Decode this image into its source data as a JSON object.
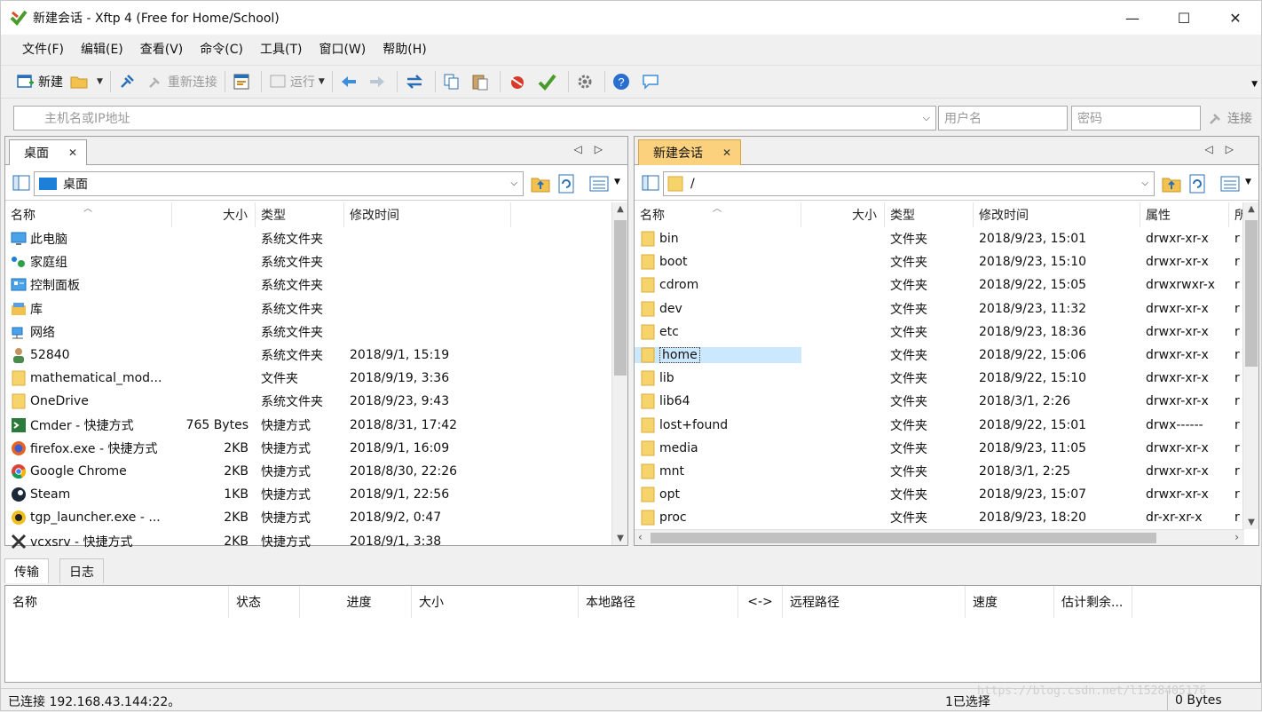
{
  "window": {
    "title": "新建会话 - Xftp 4 (Free for Home/School)",
    "controls": {
      "minimize": "—",
      "maximize": "☐",
      "close": "✕"
    }
  },
  "menu": [
    "文件(F)",
    "编辑(E)",
    "查看(V)",
    "命令(C)",
    "工具(T)",
    "窗口(W)",
    "帮助(H)"
  ],
  "toolbar": {
    "new_label": "新建",
    "reconnect_label": "重新连接",
    "run_label": "运行"
  },
  "address": {
    "host_placeholder": "主机名或IP地址",
    "user_placeholder": "用户名",
    "password_placeholder": "密码",
    "connect_label": "连接"
  },
  "left_pane": {
    "tab": "桌面",
    "path": "桌面",
    "columns": [
      "名称",
      "大小",
      "类型",
      "修改时间"
    ],
    "rows": [
      {
        "name": "此电脑",
        "size": "",
        "type": "系统文件夹",
        "modified": "",
        "icon": "computer-icon"
      },
      {
        "name": "家庭组",
        "size": "",
        "type": "系统文件夹",
        "modified": "",
        "icon": "homegroup-icon"
      },
      {
        "name": "控制面板",
        "size": "",
        "type": "系统文件夹",
        "modified": "",
        "icon": "control-panel-icon"
      },
      {
        "name": "库",
        "size": "",
        "type": "系统文件夹",
        "modified": "",
        "icon": "library-icon"
      },
      {
        "name": "网络",
        "size": "",
        "type": "系统文件夹",
        "modified": "",
        "icon": "network-icon"
      },
      {
        "name": "52840",
        "size": "",
        "type": "系统文件夹",
        "modified": "2018/9/1, 15:19",
        "icon": "user-icon"
      },
      {
        "name": "mathematical_mod...",
        "size": "",
        "type": "文件夹",
        "modified": "2018/9/19, 3:36",
        "icon": "folder-icon"
      },
      {
        "name": "OneDrive",
        "size": "",
        "type": "系统文件夹",
        "modified": "2018/9/23, 9:43",
        "icon": "folder-icon"
      },
      {
        "name": "Cmder - 快捷方式",
        "size": "765 Bytes",
        "type": "快捷方式",
        "modified": "2018/8/31, 17:42",
        "icon": "cmder-icon"
      },
      {
        "name": "firefox.exe - 快捷方式",
        "size": "2KB",
        "type": "快捷方式",
        "modified": "2018/9/1, 16:09",
        "icon": "firefox-icon"
      },
      {
        "name": "Google Chrome",
        "size": "2KB",
        "type": "快捷方式",
        "modified": "2018/8/30, 22:26",
        "icon": "chrome-icon"
      },
      {
        "name": "Steam",
        "size": "1KB",
        "type": "快捷方式",
        "modified": "2018/9/1, 22:56",
        "icon": "steam-icon"
      },
      {
        "name": "tgp_launcher.exe - ...",
        "size": "2KB",
        "type": "快捷方式",
        "modified": "2018/9/2, 0:47",
        "icon": "tgp-icon"
      },
      {
        "name": "vcxsrv - 快捷方式",
        "size": "2KB",
        "type": "快捷方式",
        "modified": "2018/9/1, 3:38",
        "icon": "x-icon"
      }
    ]
  },
  "right_pane": {
    "tab": "新建会话",
    "path": "/",
    "columns": [
      "名称",
      "大小",
      "类型",
      "修改时间",
      "属性",
      "所"
    ],
    "rows": [
      {
        "name": "bin",
        "type": "文件夹",
        "modified": "2018/9/23, 15:01",
        "attr": "drwxr-xr-x",
        "owner": "r"
      },
      {
        "name": "boot",
        "type": "文件夹",
        "modified": "2018/9/23, 15:10",
        "attr": "drwxr-xr-x",
        "owner": "r"
      },
      {
        "name": "cdrom",
        "type": "文件夹",
        "modified": "2018/9/22, 15:05",
        "attr": "drwxrwxr-x",
        "owner": "r"
      },
      {
        "name": "dev",
        "type": "文件夹",
        "modified": "2018/9/23, 11:32",
        "attr": "drwxr-xr-x",
        "owner": "r"
      },
      {
        "name": "etc",
        "type": "文件夹",
        "modified": "2018/9/23, 18:36",
        "attr": "drwxr-xr-x",
        "owner": "r"
      },
      {
        "name": "home",
        "type": "文件夹",
        "modified": "2018/9/22, 15:06",
        "attr": "drwxr-xr-x",
        "owner": "r",
        "selected": true
      },
      {
        "name": "lib",
        "type": "文件夹",
        "modified": "2018/9/22, 15:10",
        "attr": "drwxr-xr-x",
        "owner": "r"
      },
      {
        "name": "lib64",
        "type": "文件夹",
        "modified": "2018/3/1, 2:26",
        "attr": "drwxr-xr-x",
        "owner": "r"
      },
      {
        "name": "lost+found",
        "type": "文件夹",
        "modified": "2018/9/22, 15:01",
        "attr": "drwx------",
        "owner": "r"
      },
      {
        "name": "media",
        "type": "文件夹",
        "modified": "2018/9/23, 11:05",
        "attr": "drwxr-xr-x",
        "owner": "r"
      },
      {
        "name": "mnt",
        "type": "文件夹",
        "modified": "2018/3/1, 2:25",
        "attr": "drwxr-xr-x",
        "owner": "r"
      },
      {
        "name": "opt",
        "type": "文件夹",
        "modified": "2018/9/23, 15:07",
        "attr": "drwxr-xr-x",
        "owner": "r"
      },
      {
        "name": "proc",
        "type": "文件夹",
        "modified": "2018/9/23, 18:20",
        "attr": "dr-xr-xr-x",
        "owner": "r"
      }
    ]
  },
  "bottom_tabs": [
    "传输",
    "日志"
  ],
  "transfer_columns": [
    "名称",
    "状态",
    "进度",
    "大小",
    "本地路径",
    "<->",
    "远程路径",
    "速度",
    "估计剩余..."
  ],
  "status": {
    "left": "已连接 192.168.43.144:22。",
    "mid": "1已选择",
    "right": "0 Bytes"
  },
  "watermark": "https://blog.csdn.net/l1528405176",
  "colors": {
    "accent_tab": "#fbd17d",
    "selection": "#cce8ff",
    "folder": "#f7d36b"
  }
}
